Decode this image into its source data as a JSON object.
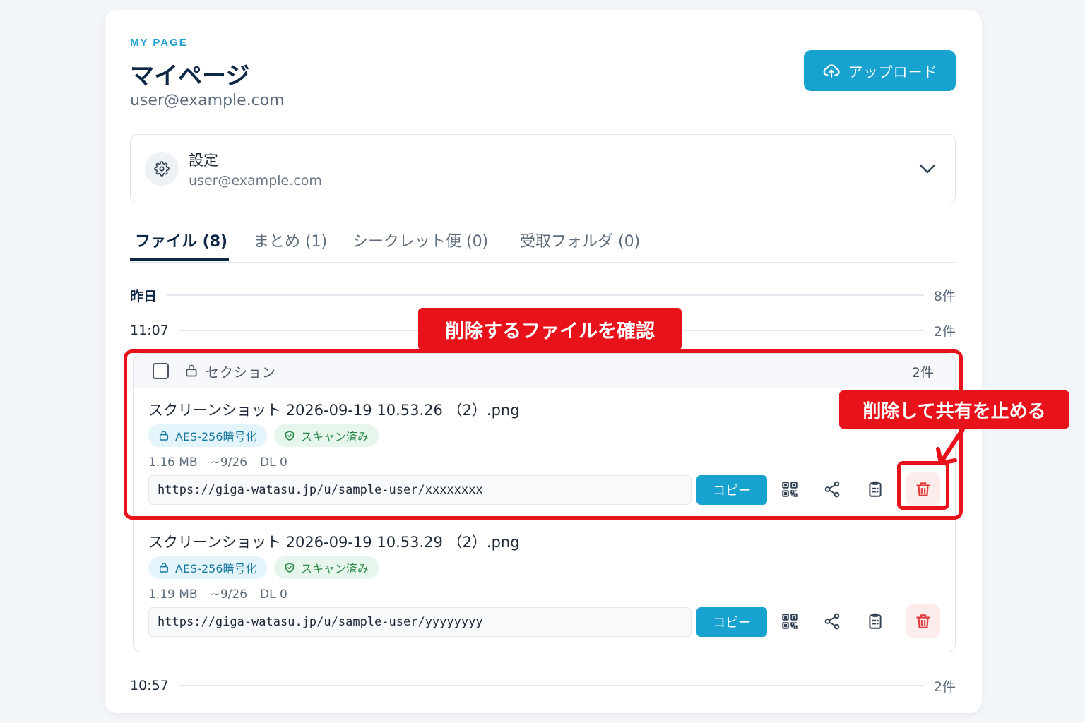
{
  "header": {
    "eyebrow": "MY PAGE",
    "title": "マイページ",
    "email": "user@example.com",
    "upload_label": "アップロード"
  },
  "settings": {
    "title": "設定",
    "subtitle": "user@example.com"
  },
  "tabs": [
    {
      "label": "ファイル (8)",
      "active": true
    },
    {
      "label": "まとめ (1)",
      "active": false
    },
    {
      "label": "シークレット便 (0)",
      "active": false
    },
    {
      "label": "受取フォルダ (0)",
      "active": false
    }
  ],
  "groups": {
    "day": {
      "label": "昨日",
      "count": "8件"
    },
    "time1": {
      "label": "11:07",
      "count": "2件"
    },
    "time2": {
      "label": "10:57",
      "count": "2件"
    }
  },
  "section": {
    "name": "セクション",
    "count": "2件"
  },
  "files": [
    {
      "name": "スクリーンショット 2026-09-19 10.53.26 （2）.png",
      "badge_encryption": "AES-256暗号化",
      "badge_scan": "スキャン済み",
      "size": "1.16 MB",
      "expiry": "~9/26",
      "downloads": "DL 0",
      "url": "https://giga-watasu.jp/u/sample-user/xxxxxxxx",
      "copy_label": "コピー"
    },
    {
      "name": "スクリーンショット 2026-09-19 10.53.29 （2）.png",
      "badge_encryption": "AES-256暗号化",
      "badge_scan": "スキャン済み",
      "size": "1.19 MB",
      "expiry": "~9/26",
      "downloads": "DL 0",
      "url": "https://giga-watasu.jp/u/sample-user/yyyyyyyy",
      "copy_label": "コピー"
    }
  ],
  "annotations": {
    "confirm": "削除するファイルを確認",
    "delete": "削除して共有を止める"
  },
  "colors": {
    "accent": "#17a2cf",
    "navy": "#0f2747",
    "annotation": "#e8131a",
    "danger_bg": "#fdecec",
    "danger": "#e23b3b"
  },
  "icons": {
    "upload": "cloud-upload-icon",
    "settings": "gear-icon",
    "expand": "chevron-down-icon",
    "section": "lock-icon",
    "encryption": "lock-icon",
    "scan": "shield-check-icon",
    "qr": "qr-code-icon",
    "share": "share-icon",
    "clipboard": "clipboard-icon",
    "delete": "trash-icon"
  }
}
